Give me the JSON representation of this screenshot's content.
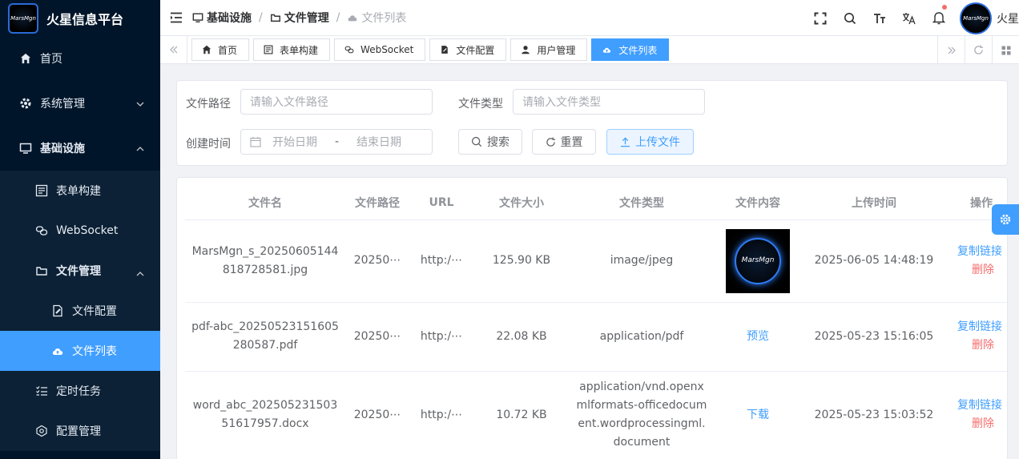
{
  "app": {
    "title": "火星信息平台",
    "logo_text": "MarsMgn",
    "user_name": "火星"
  },
  "colors": {
    "sidebar_bg": "#001529",
    "primary": "#409eff",
    "danger": "#f56c6c"
  },
  "sidebar": {
    "items": [
      {
        "label": "首页",
        "icon": "home-icon"
      },
      {
        "label": "系统管理",
        "icon": "gear-icon"
      },
      {
        "label": "基础设施",
        "icon": "monitor-icon"
      },
      {
        "label": "表单构建",
        "icon": "form-icon"
      },
      {
        "label": "WebSocket",
        "icon": "link-icon"
      },
      {
        "label": "文件管理",
        "icon": "folder-icon"
      },
      {
        "label": "文件配置",
        "icon": "file-edit-icon"
      },
      {
        "label": "文件列表",
        "icon": "cloud-upload-icon"
      },
      {
        "label": "定时任务",
        "icon": "list-check-icon"
      },
      {
        "label": "配置管理",
        "icon": "cog-box-icon"
      }
    ]
  },
  "breadcrumb": {
    "items": [
      "基础设施",
      "文件管理",
      "文件列表"
    ]
  },
  "tabs": {
    "items": [
      {
        "label": "首页",
        "icon": "home-icon"
      },
      {
        "label": "表单构建",
        "icon": "form-icon"
      },
      {
        "label": "WebSocket",
        "icon": "link-icon"
      },
      {
        "label": "文件配置",
        "icon": "file-edit-icon"
      },
      {
        "label": "用户管理",
        "icon": "user-icon"
      },
      {
        "label": "文件列表",
        "icon": "cloud-upload-icon"
      }
    ]
  },
  "search": {
    "path_label": "文件路径",
    "path_placeholder": "请输入文件路径",
    "type_label": "文件类型",
    "type_placeholder": "请输入文件类型",
    "time_label": "创建时间",
    "start_placeholder": "开始日期",
    "range_sep": "-",
    "end_placeholder": "结束日期",
    "search_btn": "搜索",
    "reset_btn": "重置",
    "upload_btn": "上传文件"
  },
  "table": {
    "columns": [
      "文件名",
      "文件路径",
      "URL",
      "文件大小",
      "文件类型",
      "文件内容",
      "上传时间",
      "操作"
    ],
    "rows": [
      {
        "name": "MarsMgn_s_20250605144818728581.jpg",
        "path": "20250⋯",
        "url": "http:/⋯",
        "size": "125.90 KB",
        "type": "image/jpeg",
        "content": "",
        "thumb_text": "MarsMgn",
        "time": "2025-06-05 14:48:19",
        "copy": "复制链接",
        "delete": "删除"
      },
      {
        "name": "pdf-abc_20250523151605280587.pdf",
        "path": "20250⋯",
        "url": "http:/⋯",
        "size": "22.08 KB",
        "type": "application/pdf",
        "content": "预览",
        "time": "2025-05-23 15:16:05",
        "copy": "复制链接",
        "delete": "删除"
      },
      {
        "name": "word_abc_20250523150351617957.docx",
        "path": "20250⋯",
        "url": "http:/⋯",
        "size": "10.72 KB",
        "type": "application/vnd.openxmlformats-officedocument.wordprocessingml.document",
        "content": "下载",
        "time": "2025-05-23 15:03:52",
        "copy": "复制链接",
        "delete": "删除"
      }
    ]
  }
}
